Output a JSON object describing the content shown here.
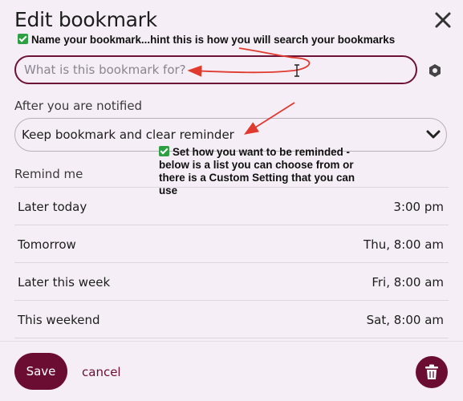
{
  "modal": {
    "title": "Edit bookmark"
  },
  "annotations": {
    "name_hint": "Name your bookmark...hint this is how you will search your bookmarks",
    "reminder_hint": "Set how you want to be reminded - below is a list you can choose from or there is a Custom Setting that you can use"
  },
  "name_field": {
    "value": "",
    "placeholder": "What is this bookmark for?"
  },
  "after_notified": {
    "label": "After you are notified",
    "selected": "Keep bookmark and clear reminder"
  },
  "remind": {
    "label": "Remind me",
    "options": [
      {
        "label": "Later today",
        "time": "3:00 pm"
      },
      {
        "label": "Tomorrow",
        "time": "Thu, 8:00 am"
      },
      {
        "label": "Later this week",
        "time": "Fri, 8:00 am"
      },
      {
        "label": "This weekend",
        "time": "Sat, 8:00 am"
      }
    ]
  },
  "footer": {
    "save_label": "Save",
    "cancel_label": "cancel"
  },
  "colors": {
    "accent": "#6b0d33",
    "background": "#f6eef6",
    "annotation_arrow": "#e03a2f",
    "checkmark": "#2ea043"
  },
  "icons": [
    "close-icon",
    "gear-icon",
    "chevron-down-icon",
    "trash-icon",
    "checkmark-icon"
  ]
}
